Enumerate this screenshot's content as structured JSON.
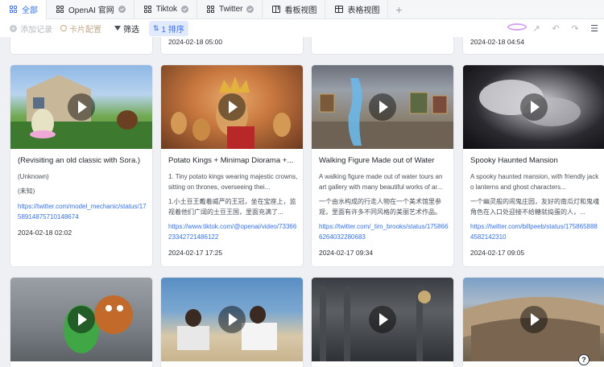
{
  "tabs": [
    {
      "label": "全部",
      "icon": "grid-icon",
      "active": true,
      "shield": false
    },
    {
      "label": "OpenAI 官网",
      "icon": "grid-icon",
      "active": false,
      "shield": true
    },
    {
      "label": "Tiktok",
      "icon": "grid-icon",
      "active": false,
      "shield": true
    },
    {
      "label": "Twitter",
      "icon": "grid-icon",
      "active": false,
      "shield": true
    },
    {
      "label": "看板视图",
      "icon": "kanban-icon",
      "active": false,
      "shield": false
    },
    {
      "label": "表格视图",
      "icon": "table-icon",
      "active": false,
      "shield": false
    }
  ],
  "tab_add": "+",
  "toolbar": {
    "add_record": "添加记录",
    "card_config": "卡片配置",
    "filter": "筛选",
    "sort": "1 排序",
    "right_icons": [
      "palette-icon",
      "share-icon",
      "undo-icon",
      "redo-icon",
      "expand-icon"
    ]
  },
  "top_row": [
    {
      "date": ""
    },
    {
      "date": "2024-02-18 05:00"
    },
    {
      "date": ""
    },
    {
      "date": "2024-02-18 04:54"
    }
  ],
  "cards": [
    {
      "title": "(Revisiting an old classic with Sora.)",
      "line1": "(Unknown)",
      "line2": "(未知)",
      "link": "https://twitter.com/model_mechanic/status/1758914875710148674",
      "date": "2024-02-18 02:02"
    },
    {
      "title": "Potato Kings + Minimap Diorama +...",
      "line1": "1. Tiny potato kings wearing majestic crowns, sitting on thrones, overseeing thei...",
      "line2": "1.小土豆王戴着威严的王冠，坐在宝座上，监视着他们广阔的土豆王国，里面充满了...",
      "link": "https://www.tiktok.com/@openai/video/7336623342721486122",
      "date": "2024-02-17 17:25"
    },
    {
      "title": "Walking Figure Made out of Water",
      "line1": "A walking figure made out of water tours an art gallery with many beautiful works of ar...",
      "line2": "一个由水构成的行走人物在一个美术馆里参观，里面有许多不同风格的美丽艺术作品。",
      "link": "https://twitter.com/_tim_brooks/status/1758666264032280683",
      "date": "2024-02-17 09:34"
    },
    {
      "title": "Spooky Haunted Mansion",
      "line1": "A spooky haunted mansion, with friendly jack o lanterns and ghost characters...",
      "line2": "一个幽灵般的闹鬼庄园，友好的南瓜灯和鬼魂角色在入口处迎接不给糖就捣蛋的人，...",
      "link": "https://twitter.com/billpeeb/status/1758658884582142310",
      "date": "2024-02-17 09:05"
    }
  ],
  "help_label": "?"
}
